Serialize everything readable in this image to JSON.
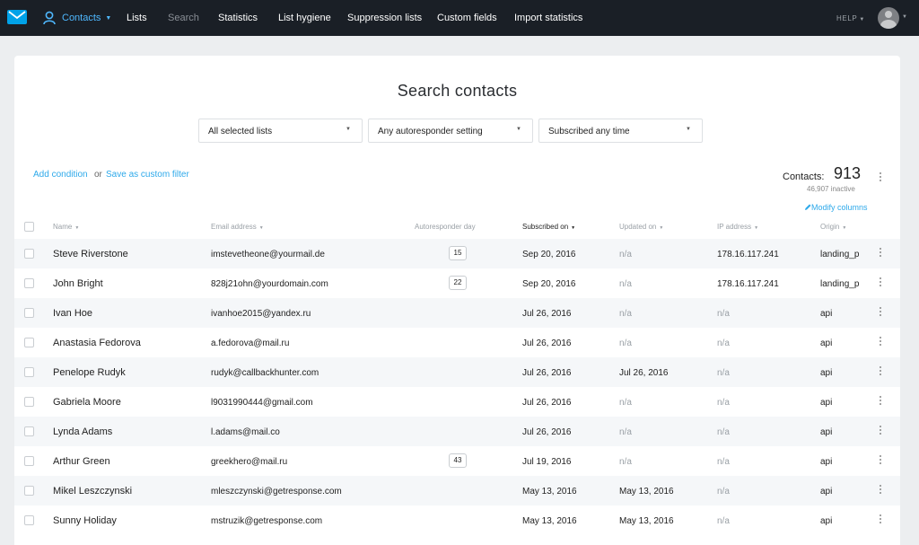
{
  "nav": {
    "contacts": "Contacts",
    "items": [
      "Lists",
      "Search",
      "Statistics",
      "List hygiene",
      "Suppression lists",
      "Custom fields",
      "Import statistics"
    ],
    "help": "HELP"
  },
  "page": {
    "title": "Search contacts",
    "filters": [
      "All selected lists",
      "Any autoresponder setting",
      "Subscribed any time"
    ],
    "add_condition": "Add condition",
    "or": "or",
    "save_filter": "Save as custom filter",
    "contacts_label": "Contacts:",
    "contacts_count": "913",
    "inactive": "46,907 inactive",
    "modify_columns": "Modify columns"
  },
  "table": {
    "columns": [
      "Name",
      "Email address",
      "Autoresponder day",
      "Subscribed on",
      "Updated on",
      "IP address",
      "Origin"
    ],
    "rows": [
      {
        "name": "Steve Riverstone",
        "email": "imstevetheone@yourmail.de",
        "day": "15",
        "subscribed": "Sep 20, 2016",
        "updated": "n/a",
        "ip": "178.16.117.241",
        "origin": "landing_p"
      },
      {
        "name": "John Bright",
        "email": "828j21ohn@yourdomain.com",
        "day": "22",
        "subscribed": "Sep 20, 2016",
        "updated": "n/a",
        "ip": "178.16.117.241",
        "origin": "landing_p"
      },
      {
        "name": "Ivan Hoe",
        "email": "ivanhoe2015@yandex.ru",
        "day": "",
        "subscribed": "Jul 26, 2016",
        "updated": "n/a",
        "ip": "n/a",
        "origin": "api"
      },
      {
        "name": "Anastasia Fedorova",
        "email": "a.fedorova@mail.ru",
        "day": "",
        "subscribed": "Jul 26, 2016",
        "updated": "n/a",
        "ip": "n/a",
        "origin": "api"
      },
      {
        "name": "Penelope Rudyk",
        "email": "rudyk@callbackhunter.com",
        "day": "",
        "subscribed": "Jul 26, 2016",
        "updated": "Jul 26, 2016",
        "ip": "n/a",
        "origin": "api"
      },
      {
        "name": "Gabriela Moore",
        "email": "l9031990444@gmail.com",
        "day": "",
        "subscribed": "Jul 26, 2016",
        "updated": "n/a",
        "ip": "n/a",
        "origin": "api"
      },
      {
        "name": "Lynda Adams",
        "email": "l.adams@mail.co",
        "day": "",
        "subscribed": "Jul 26, 2016",
        "updated": "n/a",
        "ip": "n/a",
        "origin": "api"
      },
      {
        "name": "Arthur Green",
        "email": "greekhero@mail.ru",
        "day": "43",
        "subscribed": "Jul 19, 2016",
        "updated": "n/a",
        "ip": "n/a",
        "origin": "api"
      },
      {
        "name": "Mikel Leszczynski",
        "email": "mleszczynski@getresponse.com",
        "day": "",
        "subscribed": "May 13, 2016",
        "updated": "May 13, 2016",
        "ip": "n/a",
        "origin": "api"
      },
      {
        "name": "Sunny Holiday",
        "email": "mstruzik@getresponse.com",
        "day": "",
        "subscribed": "May 13, 2016",
        "updated": "May 13, 2016",
        "ip": "n/a",
        "origin": "api"
      }
    ]
  },
  "colors": {
    "topbar": "#1a1f26",
    "accent": "#2ea9ea",
    "logo": "#00a2e8"
  }
}
